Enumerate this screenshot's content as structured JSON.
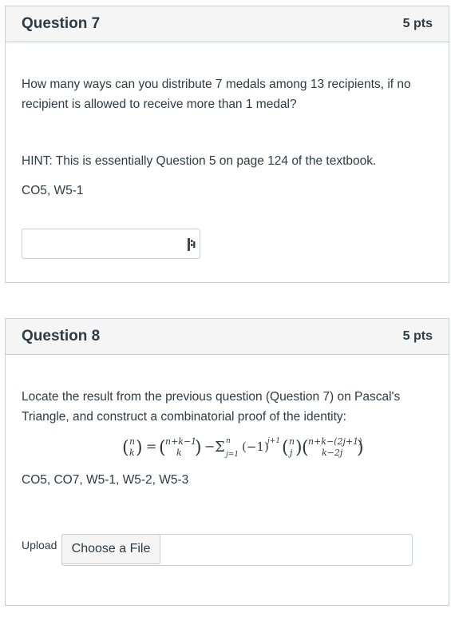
{
  "q7": {
    "title": "Question 7",
    "points": "5 pts",
    "text_line1": "How many ways can you distribute 7 medals among 13 recipients, if no",
    "text_line2": "recipient is allowed to receive more than 1 medal?",
    "hint": "HINT: This is essentially Question 5 on page 124 of the textbook.",
    "outcomes": "CO5, W5-1",
    "answer_value": ""
  },
  "q8": {
    "title": "Question 8",
    "points": "5 pts",
    "text_line1": "Locate the result from the previous question (Question 7) on Pascal's",
    "text_line2": "Triangle, and construct a combinatorial proof of the identity:",
    "outcomes": "CO5, CO7, W5-1, W5-2, W5-3",
    "upload_label": "Upload",
    "choose_file_label": "Choose a File"
  }
}
